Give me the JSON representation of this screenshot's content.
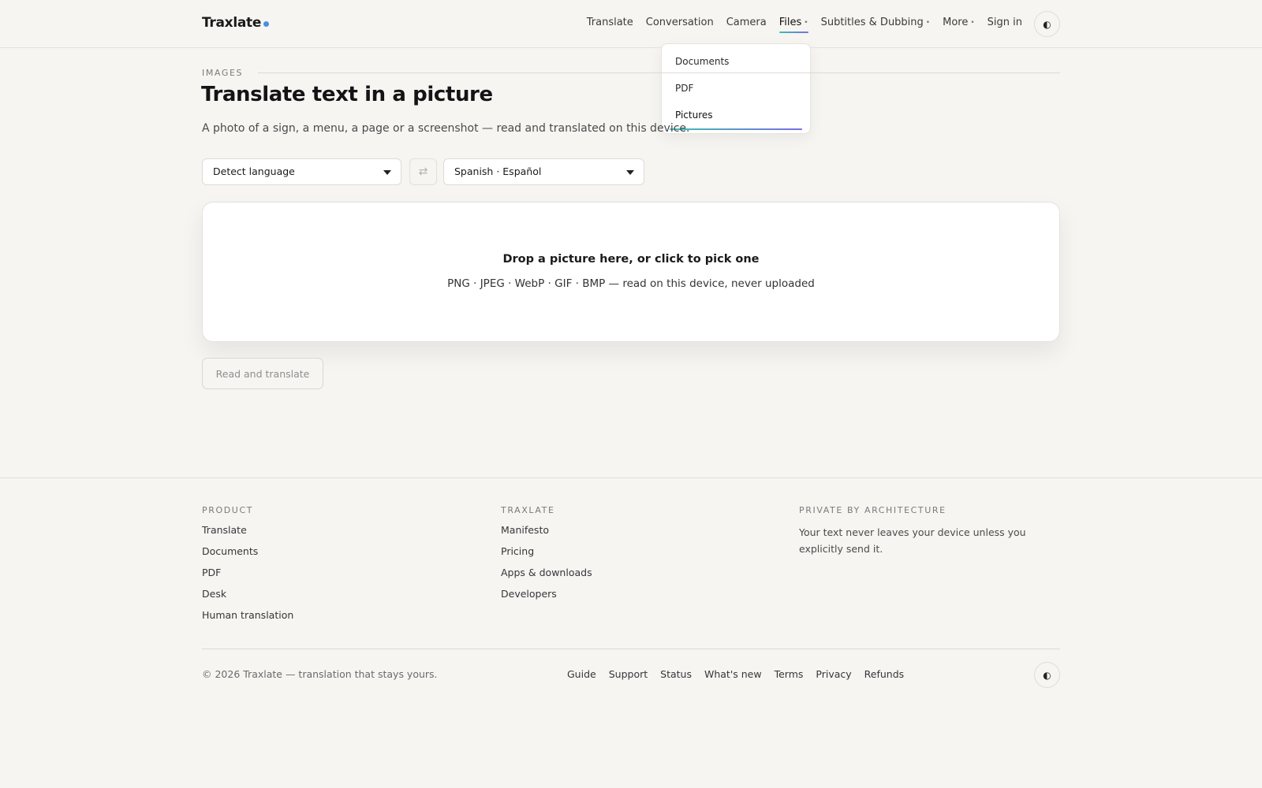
{
  "header": {
    "brand": "Traxlate",
    "nav": [
      {
        "label": "Translate",
        "caret": ""
      },
      {
        "label": "Conversation",
        "caret": ""
      },
      {
        "label": "Camera",
        "caret": ""
      },
      {
        "label": "Files",
        "caret": "•"
      },
      {
        "label": "Subtitles & Dubbing",
        "caret": "•"
      },
      {
        "label": "More",
        "caret": "•"
      },
      {
        "label": "Sign in",
        "caret": ""
      }
    ],
    "theme_icon": "◐"
  },
  "files_menu": {
    "items": [
      "Documents",
      "PDF",
      "Pictures"
    ]
  },
  "main": {
    "eyebrow": "IMAGES",
    "title": "Translate text in a picture",
    "subtitle": "A photo of a sign, a menu, a page or a screenshot — read and translated on this device.",
    "source_language": "Detect language",
    "swap_icon": "⇄",
    "target_language": "Spanish · Español",
    "dropzone_title": "Drop a picture here, or click to pick one",
    "dropzone_hint": "PNG · JPEG · WebP · GIF · BMP — read on this device, never uploaded",
    "action_label": "Read and translate"
  },
  "footer": {
    "product_heading": "PRODUCT",
    "product_links": [
      "Translate",
      "Documents",
      "PDF",
      "Desk",
      "Human translation"
    ],
    "company_heading": "TRAXLATE",
    "company_links": [
      "Manifesto",
      "Pricing",
      "Apps & downloads",
      "Developers"
    ],
    "privacy_heading": "PRIVATE BY ARCHITECTURE",
    "privacy_text": "Your text never leaves your device unless you explicitly send it.",
    "copyright": "© 2026 Traxlate — translation that stays yours.",
    "bottom_links": [
      "Guide",
      "Support",
      "Status",
      "What's new",
      "Terms",
      "Privacy",
      "Refunds"
    ],
    "theme_icon": "◐"
  },
  "colors": {
    "background": "#f6f5f1",
    "accent_gradient_start": "#3fbfb0",
    "accent_gradient_end": "#7a6de6",
    "brand_dot": "#4a8fe0"
  }
}
